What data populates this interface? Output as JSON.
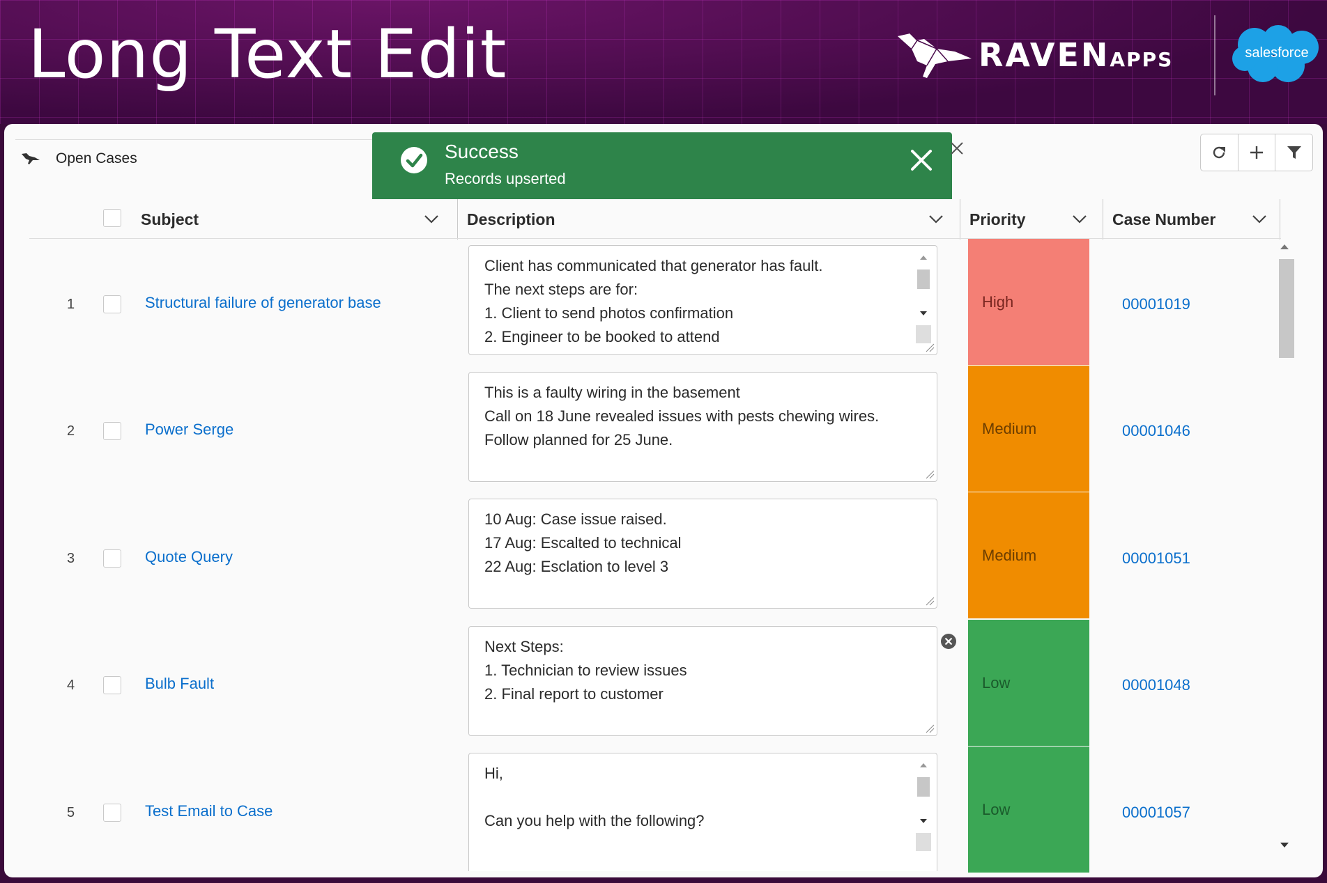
{
  "banner": {
    "title": "Long Text Edit",
    "brand_raven": "RAVEN",
    "brand_apps": "APPS",
    "brand_salesforce": "salesforce"
  },
  "list": {
    "title": "Open Cases"
  },
  "toast": {
    "title": "Success",
    "message": "Records upserted",
    "color": "#2e844a"
  },
  "columns": {
    "subject": "Subject",
    "description": "Description",
    "priority": "Priority",
    "case_number": "Case Number"
  },
  "rows": [
    {
      "num": "1",
      "subject": "Structural failure of generator base",
      "description": [
        "Client has communicated that generator has fault.",
        "The next steps are for:",
        "1. Client to send photos confirmation",
        "2. Engineer to be booked to attend"
      ],
      "priority": "High",
      "priority_color": "#f47f75",
      "case_number": "00001019"
    },
    {
      "num": "2",
      "subject": "Power Serge",
      "description": [
        "This is a faulty wiring in the basement",
        "Call on 18 June revealed issues with pests chewing wires.",
        "Follow planned for 25 June."
      ],
      "priority": "Medium",
      "priority_color": "#f08c00",
      "case_number": "00001046"
    },
    {
      "num": "3",
      "subject": "Quote Query",
      "description": [
        "10 Aug: Case issue raised.",
        "17 Aug: Escalted to technical",
        "22 Aug: Esclation to level 3"
      ],
      "priority": "Medium",
      "priority_color": "#f08c00",
      "case_number": "00001051"
    },
    {
      "num": "4",
      "subject": "Bulb Fault",
      "description": [
        "Next Steps:",
        "1. Technician to review issues",
        "2. Final report to customer"
      ],
      "priority": "Low",
      "priority_color": "#3ba755",
      "case_number": "00001048"
    },
    {
      "num": "5",
      "subject": "Test Email to Case",
      "description": [
        "Hi,",
        "",
        "Can you help with the following?"
      ],
      "priority": "Low",
      "priority_color": "#3ba755",
      "case_number": "00001057"
    }
  ]
}
